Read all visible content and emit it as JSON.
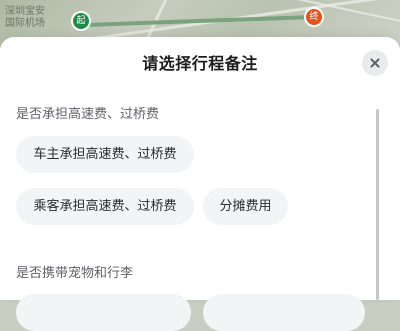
{
  "map": {
    "label_lines": [
      "深圳宝安",
      "国际机场"
    ],
    "start_marker": "起",
    "end_marker": "终"
  },
  "sheet": {
    "title": "请选择行程备注",
    "close_icon": "close-icon",
    "sections": [
      {
        "label": "是否承担高速费、过桥费",
        "options": [
          "车主承担高速费、过桥费",
          "乘客承担高速费、过桥费",
          "分摊费用"
        ]
      },
      {
        "label": "是否携带宠物和行李",
        "options": [
          "",
          ""
        ]
      }
    ]
  },
  "colors": {
    "start_marker": "#1f8a48",
    "end_marker": "#e5531f",
    "route": "#7aa37b",
    "chip_bg": "#f3f4f6"
  }
}
